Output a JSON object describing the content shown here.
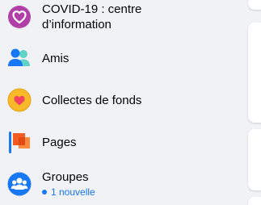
{
  "menu": {
    "items": [
      {
        "label": "COVID-19 : centre d’information",
        "icon": "covid-heart-icon"
      },
      {
        "label": "Amis",
        "icon": "friends-icon"
      },
      {
        "label": "Collectes de fonds",
        "icon": "fundraiser-heart-icon"
      },
      {
        "label": "Pages",
        "icon": "pages-flag-icon"
      },
      {
        "label": "Groupes",
        "icon": "groups-icon",
        "sub": "1 nouvelle"
      }
    ]
  },
  "colors": {
    "background": "#f0f2f5",
    "accent": "#1877f2",
    "covid": "#b03fa8",
    "fundraiser": "#f7b928",
    "pages": "#f25c22"
  }
}
